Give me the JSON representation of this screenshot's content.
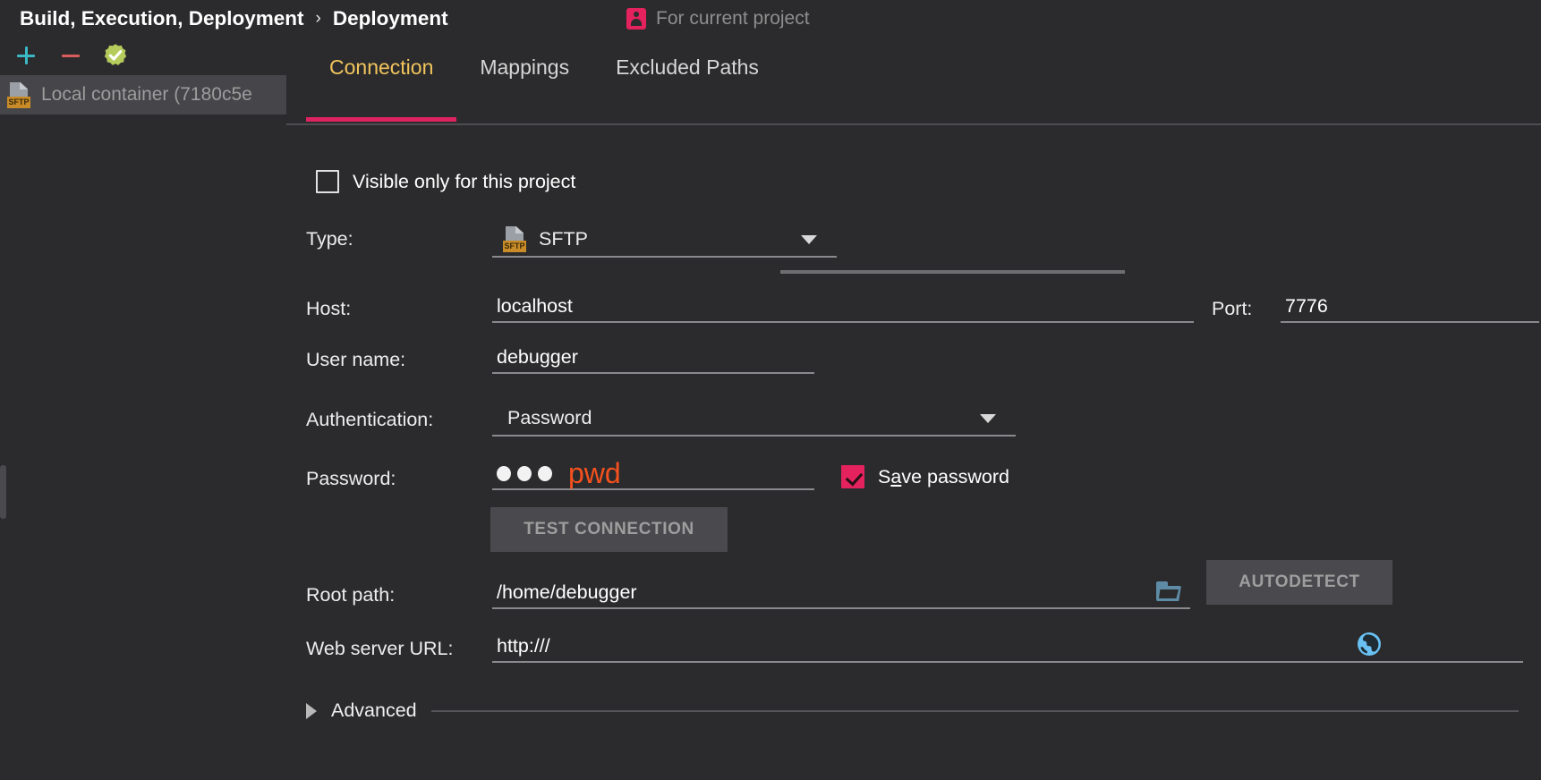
{
  "header": {
    "breadcrumb": [
      "Build, Execution, Deployment",
      "Deployment"
    ],
    "breadcrumb_separator": "›",
    "scope_note": "For current project",
    "scope_icon": "person-icon",
    "accent_pink": "#E4225E"
  },
  "sidebar": {
    "toolbar": [
      {
        "name": "add-button",
        "icon": "plus-icon",
        "color": "#3AB8C4"
      },
      {
        "name": "remove-button",
        "icon": "minus-icon",
        "color": "#DB5C5C"
      },
      {
        "name": "verify-button",
        "icon": "verified-check-icon",
        "color": "#B5CC5C"
      }
    ],
    "items": [
      {
        "label": "Local container (7180c5e",
        "icon": "sftp-file-icon",
        "icon_tag": "SFTP",
        "selected": true
      }
    ]
  },
  "tabs": [
    {
      "label": "Connection",
      "active": true
    },
    {
      "label": "Mappings",
      "active": false
    },
    {
      "label": "Excluded Paths",
      "active": false
    }
  ],
  "form": {
    "visible_only": {
      "label": "Visible only for this project",
      "checked": false
    },
    "type": {
      "label": "Type:",
      "value": "SFTP",
      "icon": "sftp-file-icon",
      "icon_tag": "SFTP"
    },
    "host": {
      "label": "Host:",
      "value": "localhost"
    },
    "port": {
      "label": "Port:",
      "value": "7776"
    },
    "username": {
      "label": "User name:",
      "value": "debugger"
    },
    "authentication": {
      "label": "Authentication:",
      "value": "Password"
    },
    "password": {
      "label": "Password:",
      "masked_dots": 3,
      "annotation": "pwd",
      "annotation_color": "#F4511E"
    },
    "save_password": {
      "label_before": "S",
      "label_mnemonic": "a",
      "label_after": "ve password",
      "checked": true
    },
    "test_connection_button": "TEST CONNECTION",
    "root_path": {
      "label": "Root path:",
      "value": "/home/debugger",
      "browse_icon": "folder-icon"
    },
    "autodetect_button": "AUTODETECT",
    "web_server_url": {
      "label": "Web server URL:",
      "value": "http:///",
      "open_icon": "globe-icon"
    },
    "advanced": {
      "label": "Advanced",
      "expanded": false,
      "icon": "chevron-right-triangle-icon"
    }
  }
}
